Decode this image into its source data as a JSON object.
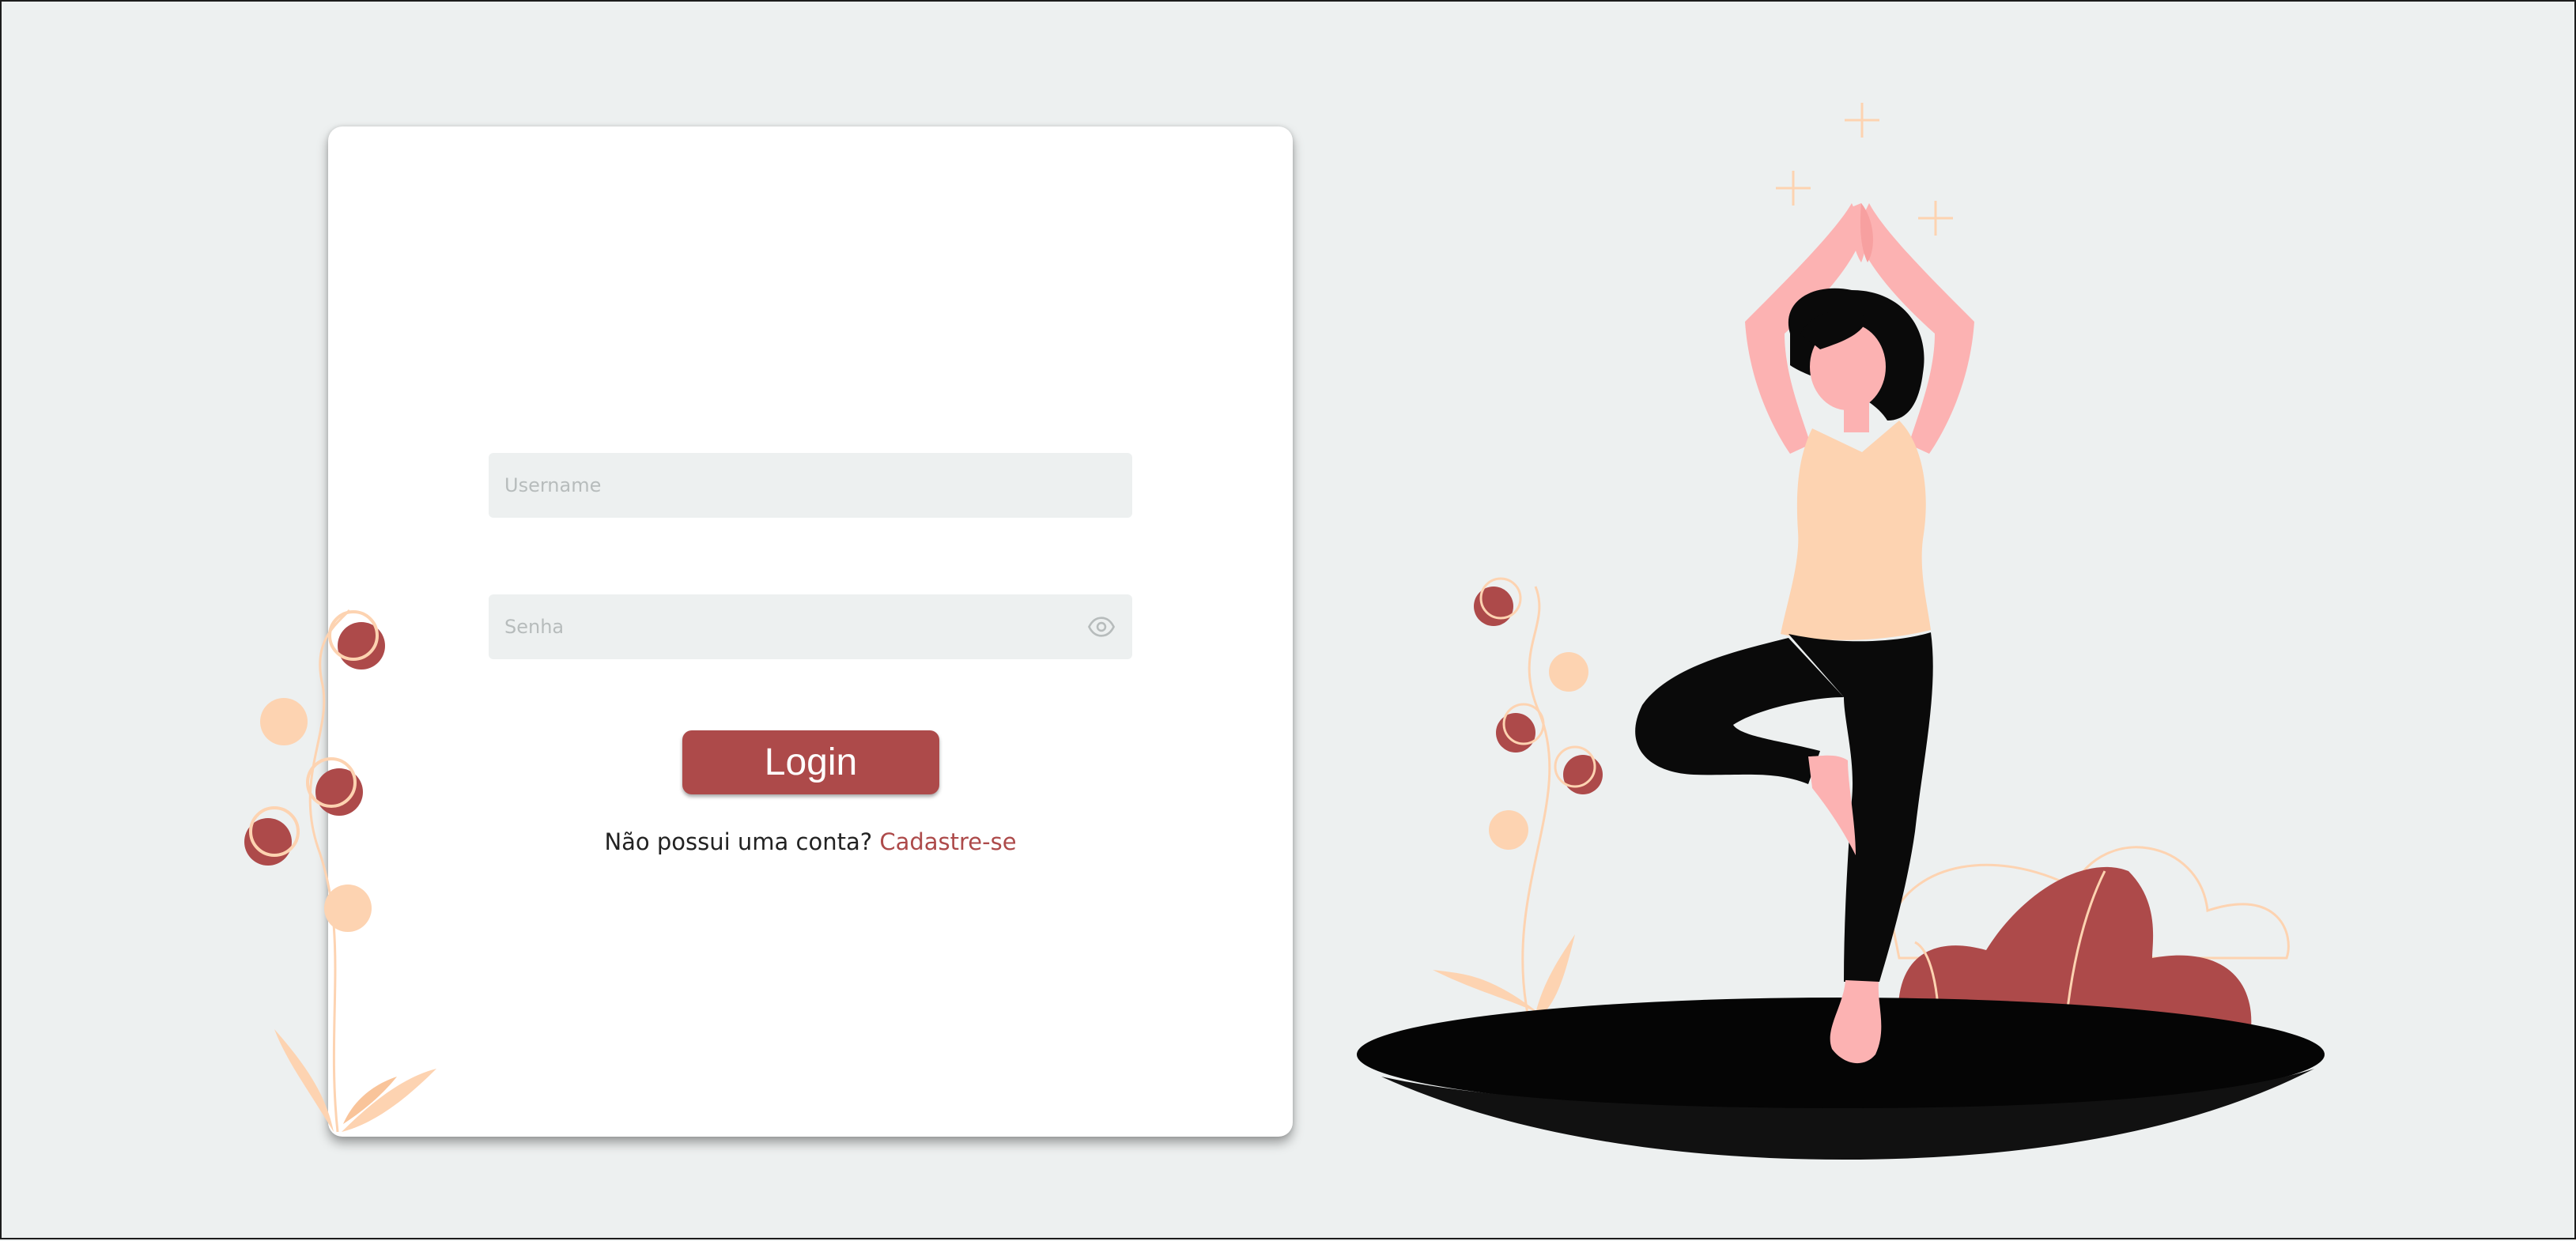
{
  "login_form": {
    "username_placeholder": "Username",
    "password_placeholder": "Senha",
    "login_label": "Login",
    "no_account_text": "Não possui uma conta?",
    "signup_link": "Cadastre-se"
  },
  "icons": {
    "password_toggle": "eye-icon",
    "left_decoration": "flower-branch-illustration",
    "right_illustration": "yoga-woman-tree-pose-illustration"
  },
  "colors": {
    "background": "#edf0f0",
    "accent": "#ad4a4a",
    "peach": "#fdd3b1",
    "skin": "#fcb2b2",
    "dark": "#0a0a0a"
  }
}
